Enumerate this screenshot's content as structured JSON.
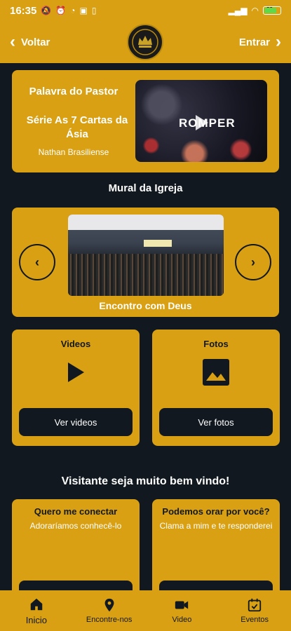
{
  "status_bar": {
    "time": "16:35",
    "battery": "89"
  },
  "header": {
    "back_label": "Voltar",
    "login_label": "Entrar"
  },
  "pastor_card": {
    "title": "Palavra do Pastor",
    "series": "Série As 7 Cartas da Ásia",
    "speaker": "Nathan Brasiliense",
    "thumbnail_text": "ROMPER"
  },
  "mural": {
    "title": "Mural da Igreja",
    "caption": "Encontro com Deus"
  },
  "tiles": {
    "videos": {
      "label": "Videos",
      "button": "Ver videos"
    },
    "fotos": {
      "label": "Fotos",
      "button": "Ver fotos"
    }
  },
  "welcome": "Visitante seja muito bem vindo!",
  "connect": {
    "left": {
      "title": "Quero me conectar",
      "text": "Adoraríamos conhecê-lo"
    },
    "right": {
      "title": "Podemos orar por você?",
      "text": "Clama a mim e te responderei"
    }
  },
  "bottom_nav": [
    {
      "label": "Inicio",
      "icon": "home-icon"
    },
    {
      "label": "Encontre-nos",
      "icon": "location-pin-icon"
    },
    {
      "label": "Video",
      "icon": "video-camera-icon"
    },
    {
      "label": "Eventos",
      "icon": "calendar-icon"
    }
  ],
  "colors": {
    "accent": "#d8a012",
    "background": "#111820"
  }
}
